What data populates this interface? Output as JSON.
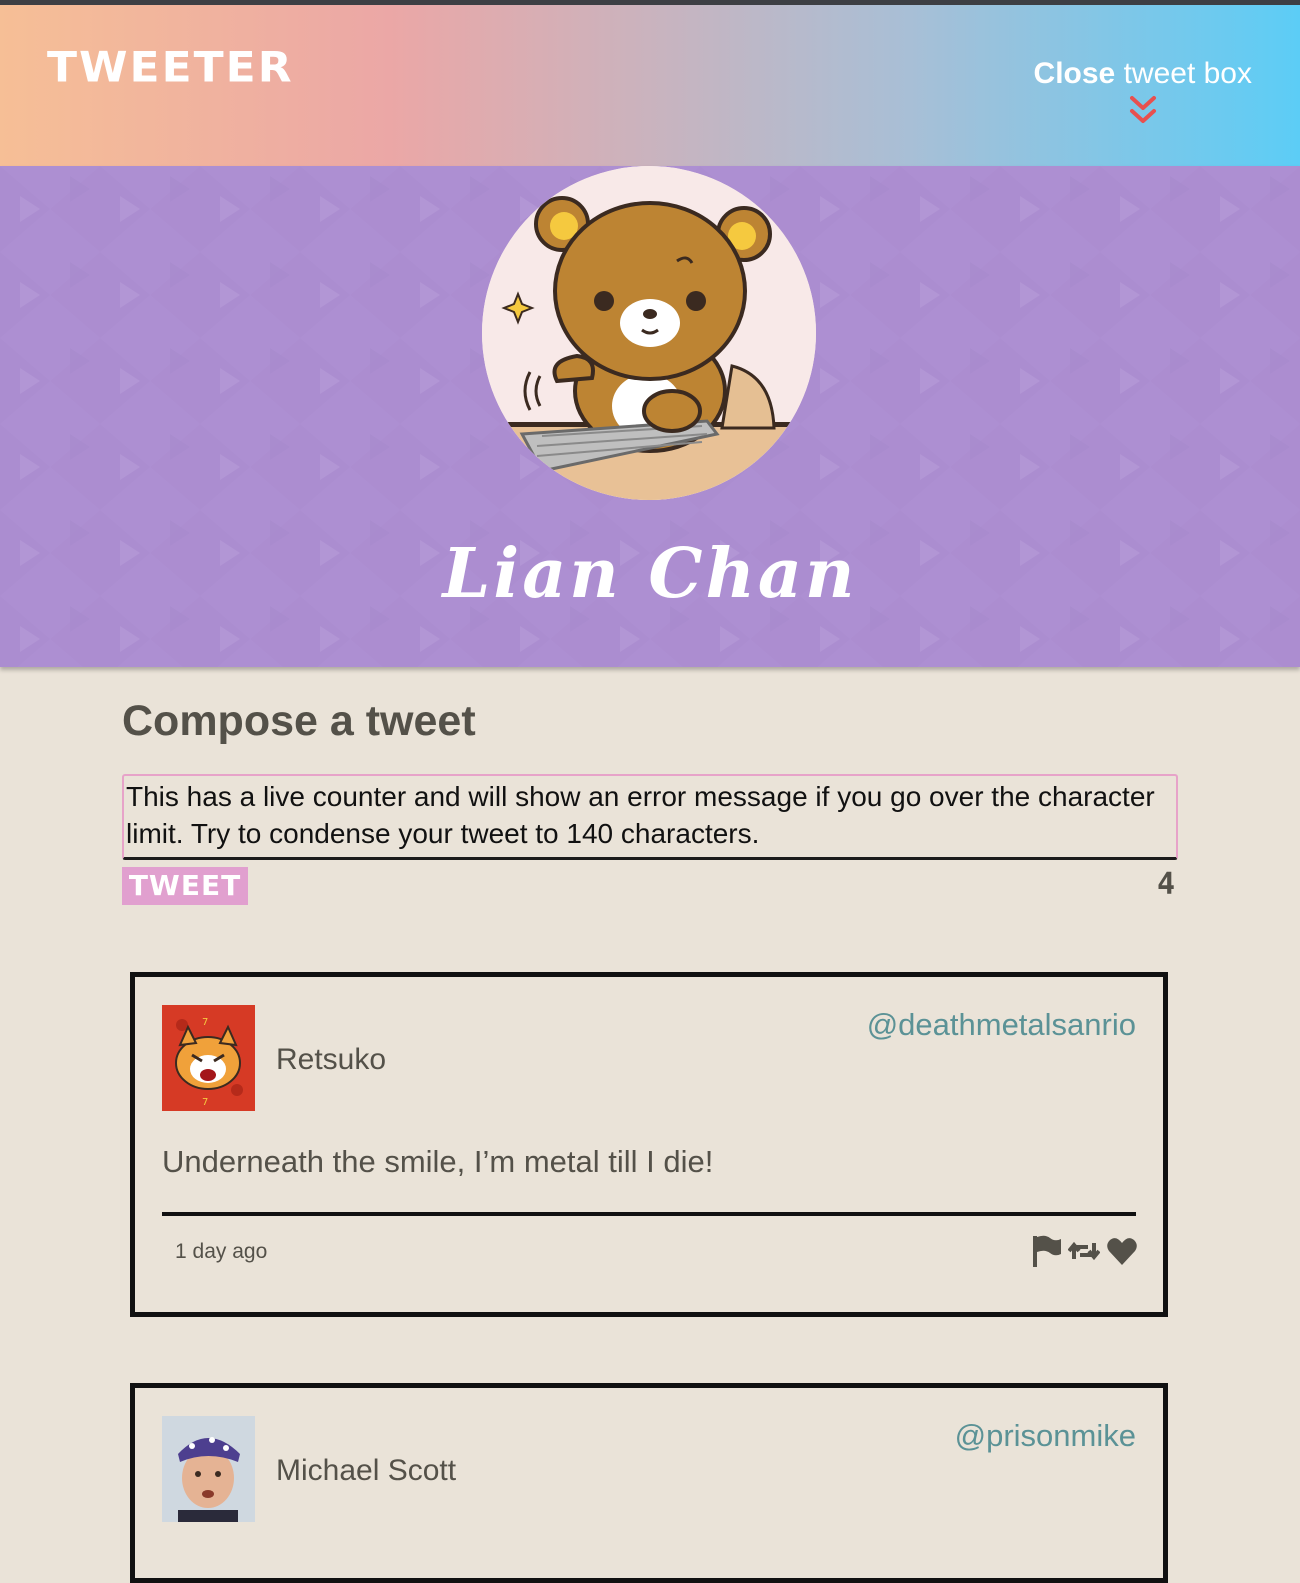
{
  "nav": {
    "brand": "TWEETER",
    "toggle_bold": "Close",
    "toggle_light": "tweet box",
    "toggle_icon": "double-chevron-down-icon"
  },
  "profile": {
    "display_name": "Lian Chan",
    "avatar": "bear-at-keyboard-avatar"
  },
  "compose": {
    "title": "Compose a tweet",
    "textarea_value": "This has a live counter and will show an error message if you go over the character limit. Try to condense your tweet to 140 characters.",
    "button_label": "TWEET",
    "counter": "4"
  },
  "tweets": [
    {
      "name": "Retsuko",
      "handle": "@deathmetalsanrio",
      "body": "Underneath the smile, I’m metal till I die!",
      "time": "1 day ago",
      "avatar": "red-panda-avatar",
      "actions": [
        "flag-icon",
        "retweet-icon",
        "heart-icon"
      ]
    },
    {
      "name": "Michael Scott",
      "handle": "@prisonmike",
      "avatar": "man-bandana-avatar"
    }
  ],
  "colors": {
    "nav_gradient_start": "#f6bf96",
    "nav_gradient_end": "#5ccdf6",
    "header_purple": "#ad8fd2",
    "page_bg": "#eae3d8",
    "accent_pink": "#e1a0cf",
    "handle_teal": "#5b9296",
    "chevron_red": "#e8504f"
  }
}
